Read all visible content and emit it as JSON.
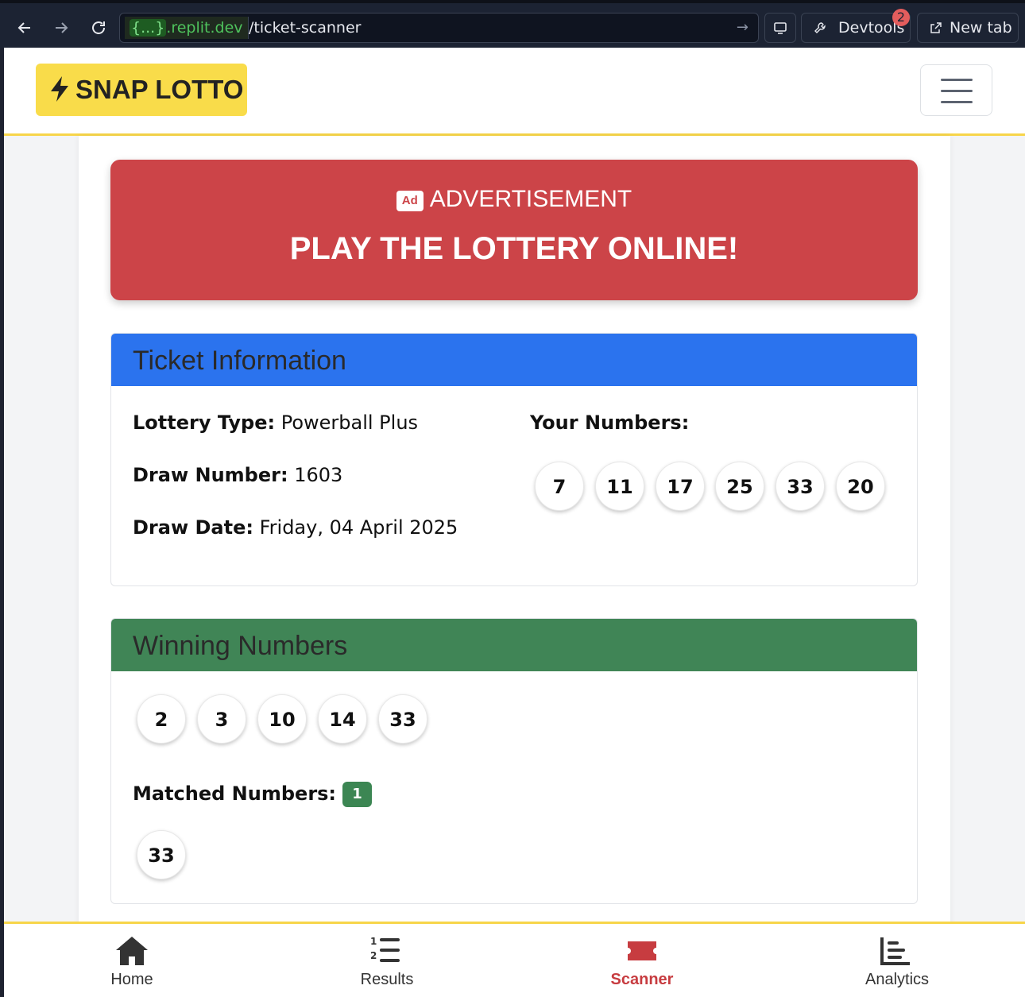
{
  "browser": {
    "url_host": ".replit.dev",
    "url_host_brace": "{...}",
    "url_path": "/ticket-scanner",
    "devtools_label": "Devtools",
    "devtools_badge": "2",
    "new_tab_label": "New tab"
  },
  "header": {
    "brand": "SNAP LOTTO"
  },
  "ad": {
    "icon_text": "Ad",
    "label": "ADVERTISEMENT",
    "title": "PLAY THE LOTTERY ONLINE!"
  },
  "ticket": {
    "heading": "Ticket Information",
    "lottery_type_label": "Lottery Type:",
    "lottery_type": "Powerball Plus",
    "draw_number_label": "Draw Number:",
    "draw_number": "1603",
    "draw_date_label": "Draw Date:",
    "draw_date": "Friday, 04 April 2025",
    "your_numbers_label": "Your Numbers:",
    "your_numbers": [
      "7",
      "11",
      "17",
      "25",
      "33",
      "20"
    ]
  },
  "winning": {
    "heading": "Winning Numbers",
    "numbers": [
      "2",
      "3",
      "10",
      "14",
      "33"
    ],
    "matched_label": "Matched Numbers:",
    "matched_count": "1",
    "matched_numbers": [
      "33"
    ]
  },
  "bottom_nav": {
    "items": [
      {
        "label": "Home",
        "icon": "home-icon"
      },
      {
        "label": "Results",
        "icon": "list-ol-icon"
      },
      {
        "label": "Scanner",
        "icon": "ticket-icon"
      },
      {
        "label": "Analytics",
        "icon": "chart-icon"
      }
    ],
    "active_index": 2,
    "active_color": "#c73c40"
  },
  "colors": {
    "brand_yellow": "#f9dc4a",
    "ad_red": "#cc4448",
    "ticket_blue": "#2b73ee",
    "winning_green": "#408556"
  }
}
